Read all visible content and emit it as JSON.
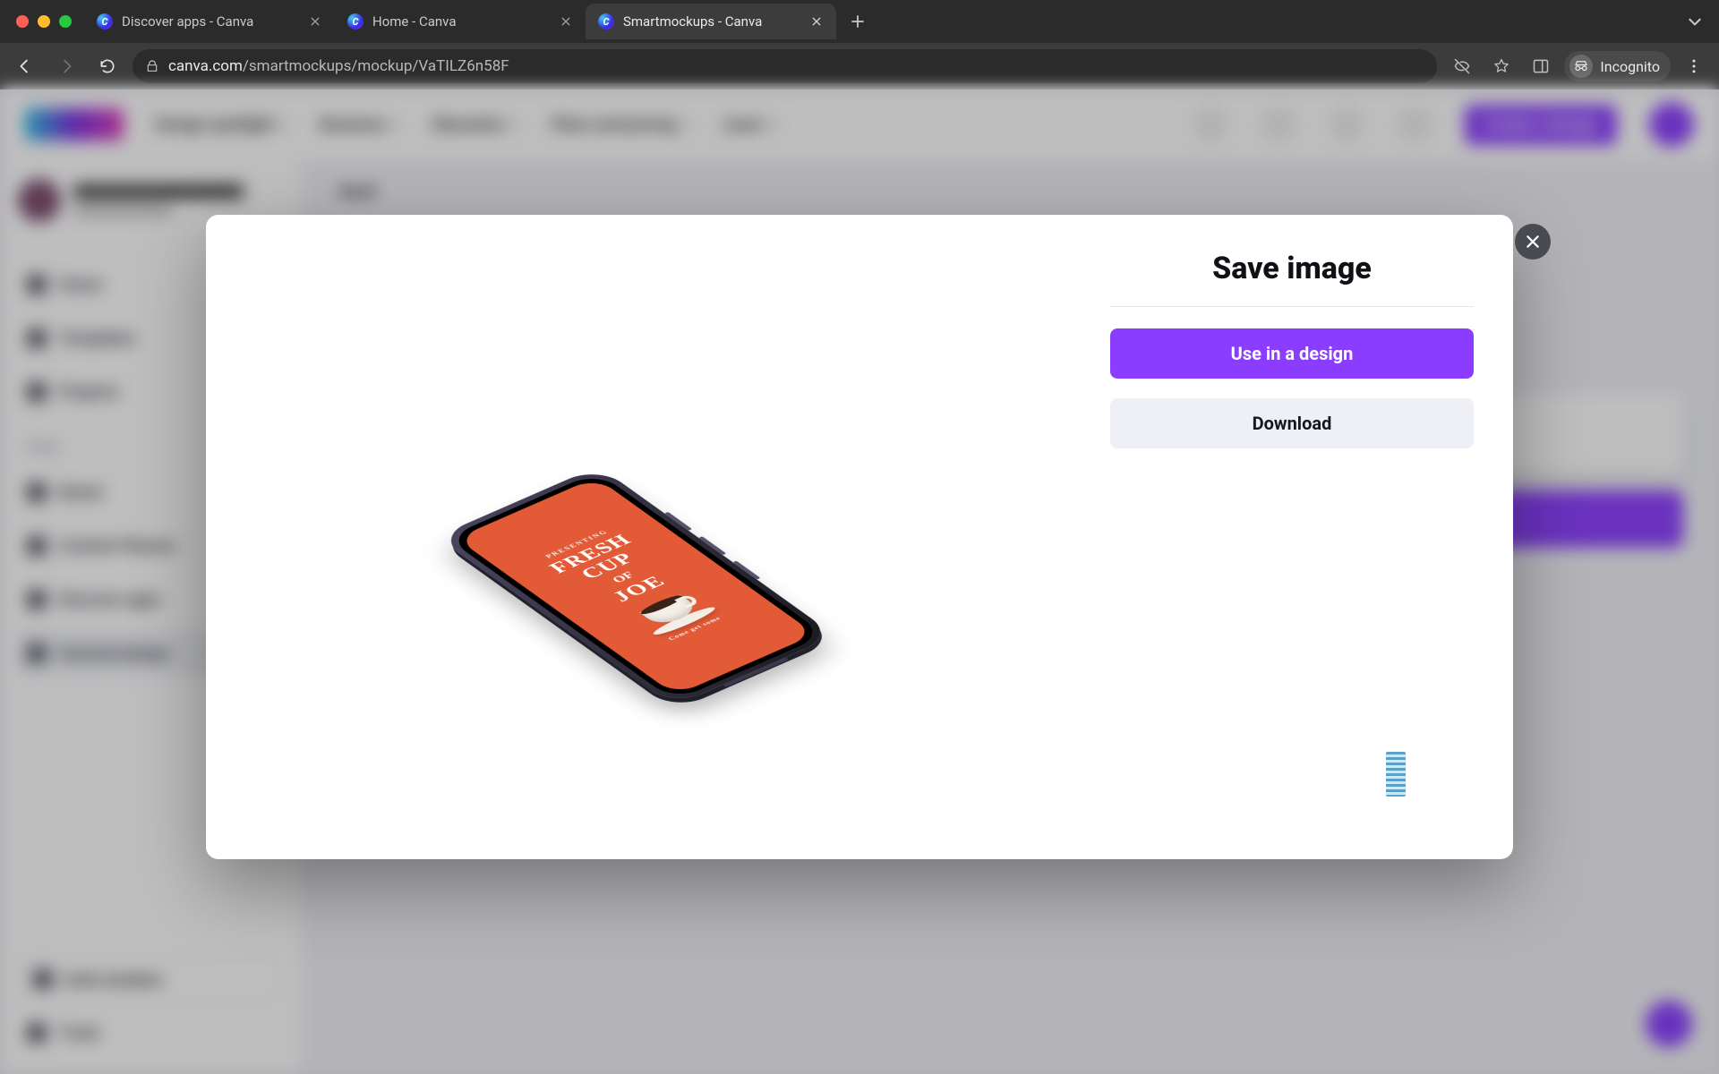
{
  "browser": {
    "traffic_lights": [
      "close",
      "minimize",
      "zoom"
    ],
    "tabs": [
      {
        "title": "Discover apps - Canva",
        "active": false
      },
      {
        "title": "Home - Canva",
        "active": false
      },
      {
        "title": "Smartmockups - Canva",
        "active": true
      }
    ],
    "toolbar": {
      "url_host": "canva.com",
      "url_path": "/smartmockups/mockup/VaTILZ6n58F",
      "incognito_label": "Incognito"
    }
  },
  "canva_app": {
    "header": {
      "nav": [
        "Design spotlight",
        "Business",
        "Education",
        "Plans and pricing",
        "Learn"
      ],
      "create_button": "Create a design"
    },
    "sidebar": {
      "team_name": "User's Team",
      "team_sub": "Free · 1",
      "items": [
        "Home",
        "Templates",
        "Projects"
      ],
      "tools_label": "Tools",
      "tools": [
        "Brand",
        "Content Planner",
        "Discover apps",
        "Smartmockups"
      ],
      "invite": "Invite members",
      "trash": "Trash"
    },
    "main": {
      "back": "‹ Back"
    }
  },
  "modal": {
    "title": "Save image",
    "primary": "Use in a design",
    "secondary": "Download",
    "mockup_screen": {
      "pre": "PRESENTING",
      "line1": "FRESH CUP",
      "of": "OF",
      "joe": "JOE",
      "cta": "Come get some"
    }
  }
}
